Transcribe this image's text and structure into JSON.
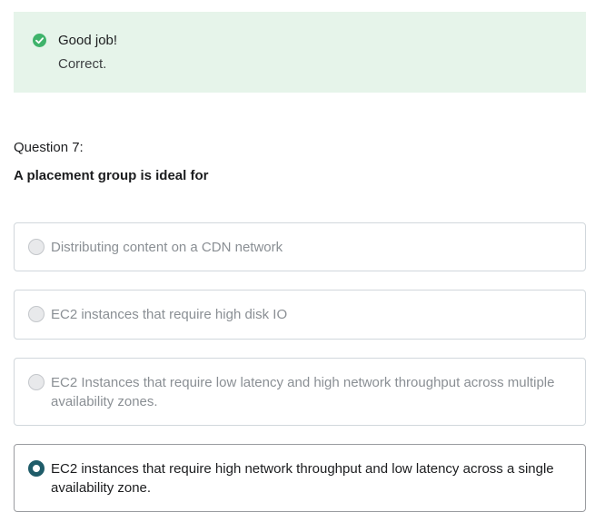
{
  "feedback": {
    "title": "Good job!",
    "message": "Correct.",
    "icon": "check-circle-icon",
    "color": "#3fb36b",
    "background": "#e6f4ea"
  },
  "question": {
    "number_label": "Question 7:",
    "text": "A placement group is ideal for"
  },
  "options": [
    {
      "label": "Distributing content on a CDN network",
      "selected": false
    },
    {
      "label": "EC2 instances that require high disk IO",
      "selected": false
    },
    {
      "label": "EC2 Instances that require low latency and high network throughput across multiple availability zones.",
      "selected": false
    },
    {
      "label": "EC2 instances that require high network throughput and low latency across a single availability zone.",
      "selected": true
    }
  ],
  "colors": {
    "selected_radio": "#1f5c69",
    "unselected_text": "#8a8f94"
  }
}
